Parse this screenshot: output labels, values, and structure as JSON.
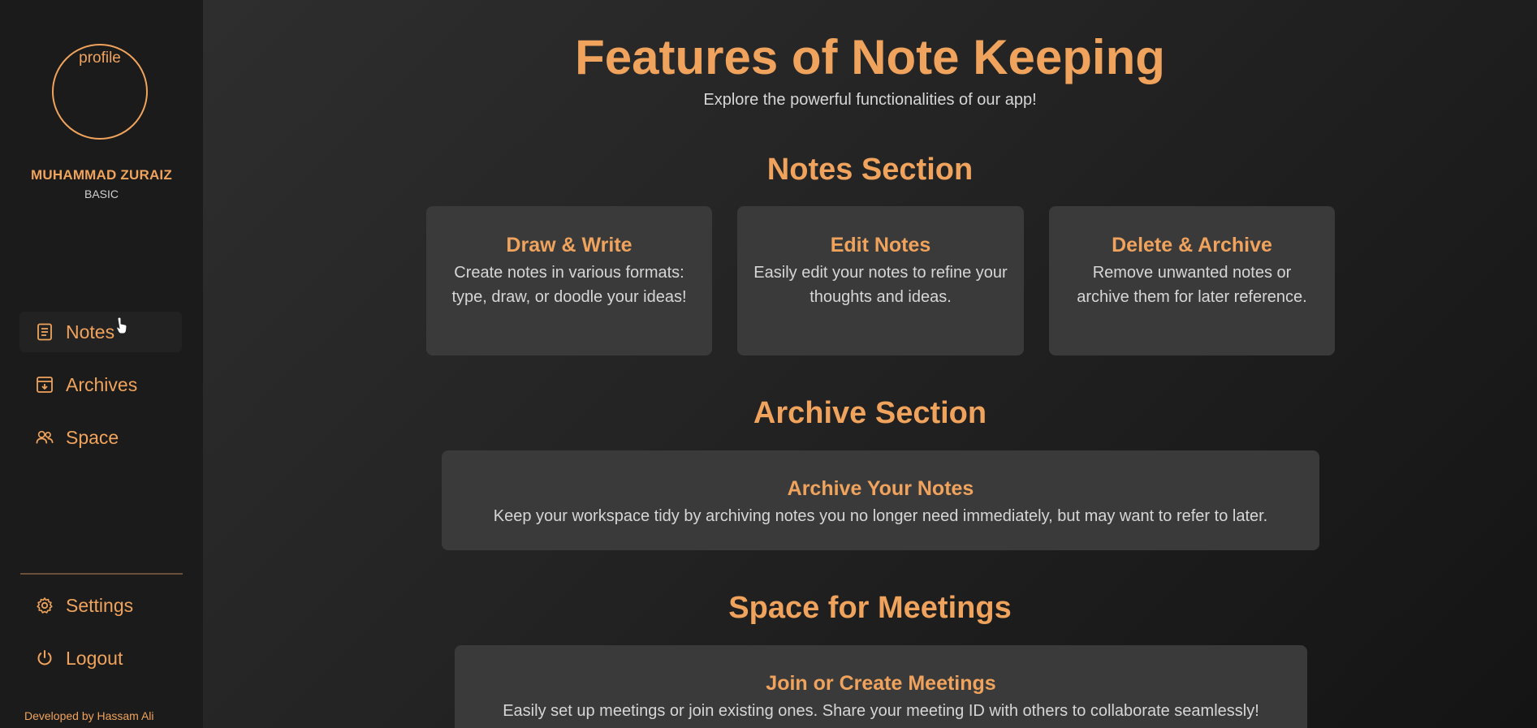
{
  "sidebar": {
    "profile_label": "profile",
    "user_name": "MUHAMMAD ZURAIZ",
    "user_plan": "BASIC",
    "nav": [
      {
        "label": "Notes",
        "icon": "notes-icon",
        "active": true
      },
      {
        "label": "Archives",
        "icon": "archive-icon",
        "active": false
      },
      {
        "label": "Space",
        "icon": "people-icon",
        "active": false
      }
    ],
    "bottom_nav": [
      {
        "label": "Settings",
        "icon": "gear-icon"
      },
      {
        "label": "Logout",
        "icon": "power-icon"
      }
    ],
    "credit": "Developed by Hassam Ali"
  },
  "main": {
    "title": "Features of Note Keeping",
    "subtitle": "Explore the powerful functionalities of our app!",
    "notes_section": {
      "title": "Notes Section",
      "cards": [
        {
          "title": "Draw & Write",
          "desc": "Create notes in various formats: type, draw, or doodle your ideas!"
        },
        {
          "title": "Edit Notes",
          "desc": "Easily edit your notes to refine your thoughts and ideas."
        },
        {
          "title": "Delete & Archive",
          "desc": "Remove unwanted notes or archive them for later reference."
        }
      ]
    },
    "archive_section": {
      "title": "Archive Section",
      "card": {
        "title": "Archive Your Notes",
        "desc": "Keep your workspace tidy by archiving notes you no longer need immediately, but may want to refer to later."
      }
    },
    "meetings_section": {
      "title": "Space for Meetings",
      "card": {
        "title": "Join or Create Meetings",
        "desc": "Easily set up meetings or join existing ones. Share your meeting ID with others to collaborate seamlessly!"
      }
    }
  },
  "colors": {
    "accent": "#f0a35c",
    "sidebar_bg": "#1b1b1b",
    "card_bg": "#3a3a3a",
    "text_muted": "#d6d6d6"
  }
}
